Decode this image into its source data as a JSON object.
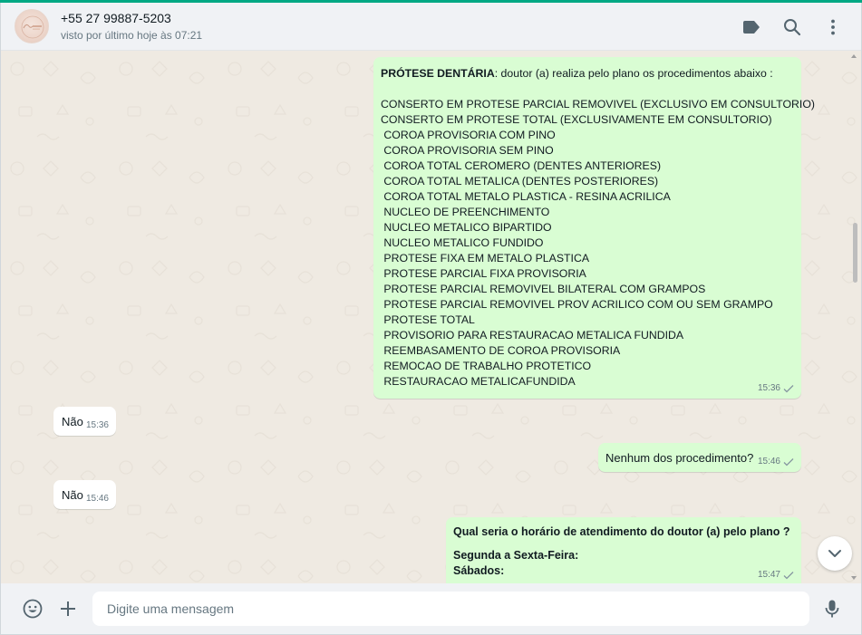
{
  "header": {
    "contact_name": "+55 27 99887-5203",
    "status": "visto por último hoje às 07:21",
    "icons": [
      "label-icon",
      "search-icon",
      "menu-icon"
    ]
  },
  "messages": {
    "procedures": {
      "title_bold": "PRÓTESE DENTÁRIA",
      "title_rest": ": doutor (a) realiza pelo plano os procedimentos abaixo :",
      "lines": [
        "CONSERTO EM PROTESE PARCIAL REMOVIVEL (EXCLUSIVO EM CONSULTORIO)",
        "CONSERTO EM PROTESE TOTAL (EXCLUSIVAMENTE EM CONSULTORIO)",
        " COROA PROVISORIA COM PINO",
        " COROA PROVISORIA SEM PINO",
        " COROA TOTAL CEROMERO (DENTES ANTERIORES)",
        " COROA TOTAL METALICA (DENTES POSTERIORES)",
        " COROA TOTAL METALO PLASTICA - RESINA ACRILICA",
        " NUCLEO DE PREENCHIMENTO",
        " NUCLEO METALICO BIPARTIDO",
        " NUCLEO METALICO FUNDIDO",
        " PROTESE FIXA EM METALO PLASTICA",
        " PROTESE PARCIAL FIXA PROVISORIA",
        " PROTESE PARCIAL REMOVIVEL BILATERAL COM GRAMPOS",
        " PROTESE PARCIAL REMOVIVEL PROV ACRILICO COM OU SEM GRAMPO",
        " PROTESE TOTAL",
        " PROVISORIO PARA RESTAURACAO METALICA FUNDIDA",
        " REEMBASAMENTO DE COROA PROVISORIA",
        " REMOCAO DE TRABALHO PROTETICO",
        " RESTAURACAO METALICAFUNDIDA"
      ],
      "time": "15:36"
    },
    "reply1": {
      "text": "Não",
      "time": "15:36"
    },
    "question": {
      "text": "Nenhum dos procedimento?",
      "time": "15:46"
    },
    "reply2": {
      "text": "Não",
      "time": "15:46"
    },
    "schedule": {
      "line1": "Qual seria o horário de atendimento do doutor (a) pelo plano ?",
      "line2": "Segunda a Sexta-Feira:",
      "line3": "Sábados:",
      "time": "15:47"
    }
  },
  "footer": {
    "placeholder": "Digite uma mensagem",
    "icons": [
      "emoji-icon",
      "plus-icon",
      "microphone-icon"
    ]
  },
  "colors": {
    "accent": "#00a884",
    "outgoing_bubble": "#d9fdd3",
    "incoming_bubble": "#ffffff",
    "chat_background": "#efeae2",
    "header_background": "#f0f2f5"
  }
}
